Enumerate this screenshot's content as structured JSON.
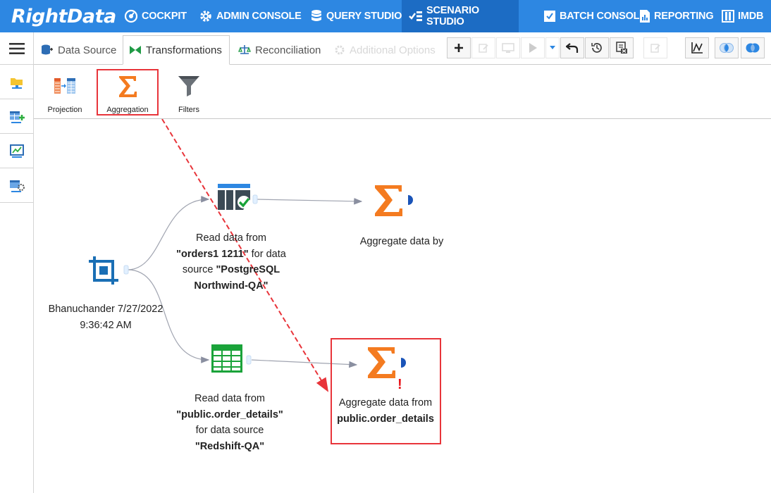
{
  "brand": {
    "name": "RightData"
  },
  "topnav": {
    "items": [
      {
        "label": "COCKPIT",
        "icon": "speedometer-icon"
      },
      {
        "label": "ADMIN CONSOLE",
        "icon": "gear-icon"
      },
      {
        "label": "QUERY STUDIO",
        "icon": "database-icon"
      },
      {
        "label": "SCENARIO STUDIO",
        "icon": "scenario-icon",
        "active": true
      },
      {
        "label": "BATCH CONSOLE",
        "icon": "batch-icon"
      },
      {
        "label": "REPORTING",
        "icon": "report-icon"
      },
      {
        "label": "IMDB",
        "icon": "imdb-icon"
      }
    ]
  },
  "sidebar": {
    "items": [
      {
        "icon": "folder-icon"
      },
      {
        "icon": "add-table-icon"
      },
      {
        "icon": "chart-icon"
      },
      {
        "icon": "settings-table-icon"
      }
    ]
  },
  "tabs": {
    "items": [
      {
        "label": "Data Source",
        "icon": "database-plug-icon"
      },
      {
        "label": "Transformations",
        "icon": "bowtie-icon",
        "active": true
      },
      {
        "label": "Reconciliation",
        "icon": "scale-icon"
      },
      {
        "label": "Additional Options",
        "icon": "gear-icon",
        "disabled": true
      }
    ]
  },
  "toolbar": {
    "buttons": [
      {
        "icon": "plus-icon"
      },
      {
        "icon": "edit-icon"
      },
      {
        "icon": "monitor-icon"
      },
      {
        "icon": "play-icon"
      },
      {
        "icon": "dropdown-caret-icon"
      },
      {
        "icon": "undo-icon"
      },
      {
        "icon": "history-icon"
      },
      {
        "icon": "excel-report-icon"
      },
      {
        "icon": "edit-note-icon"
      },
      {
        "icon": "chart-line-icon"
      },
      {
        "icon": "venn-inner-icon"
      },
      {
        "icon": "venn-outer-icon"
      }
    ]
  },
  "tools": {
    "items": [
      {
        "label": "Projection",
        "icon": "projection-icon"
      },
      {
        "label": "Aggregation",
        "icon": "sigma-icon",
        "selected": true
      },
      {
        "label": "Filters",
        "icon": "funnel-icon"
      }
    ]
  },
  "canvas": {
    "start_node": {
      "line1": "Bhanuchander 7/27/2022",
      "line2": "9:36:42 AM"
    },
    "source1": {
      "pre": "Read data from",
      "name": "\"orders1 1211\"",
      "mid": " for data",
      "mid2": "source ",
      "source": "\"PostgreSQL",
      "source2": "Northwind-QA\""
    },
    "source2": {
      "pre": "Read data from",
      "name": "\"public.order_details\"",
      "mid": "for data source",
      "source": "\"Redshift-QA\""
    },
    "agg1": {
      "label": "Aggregate data by"
    },
    "agg2": {
      "line1": "Aggregate data from",
      "line2": "public.order_details",
      "warning": "!"
    }
  }
}
